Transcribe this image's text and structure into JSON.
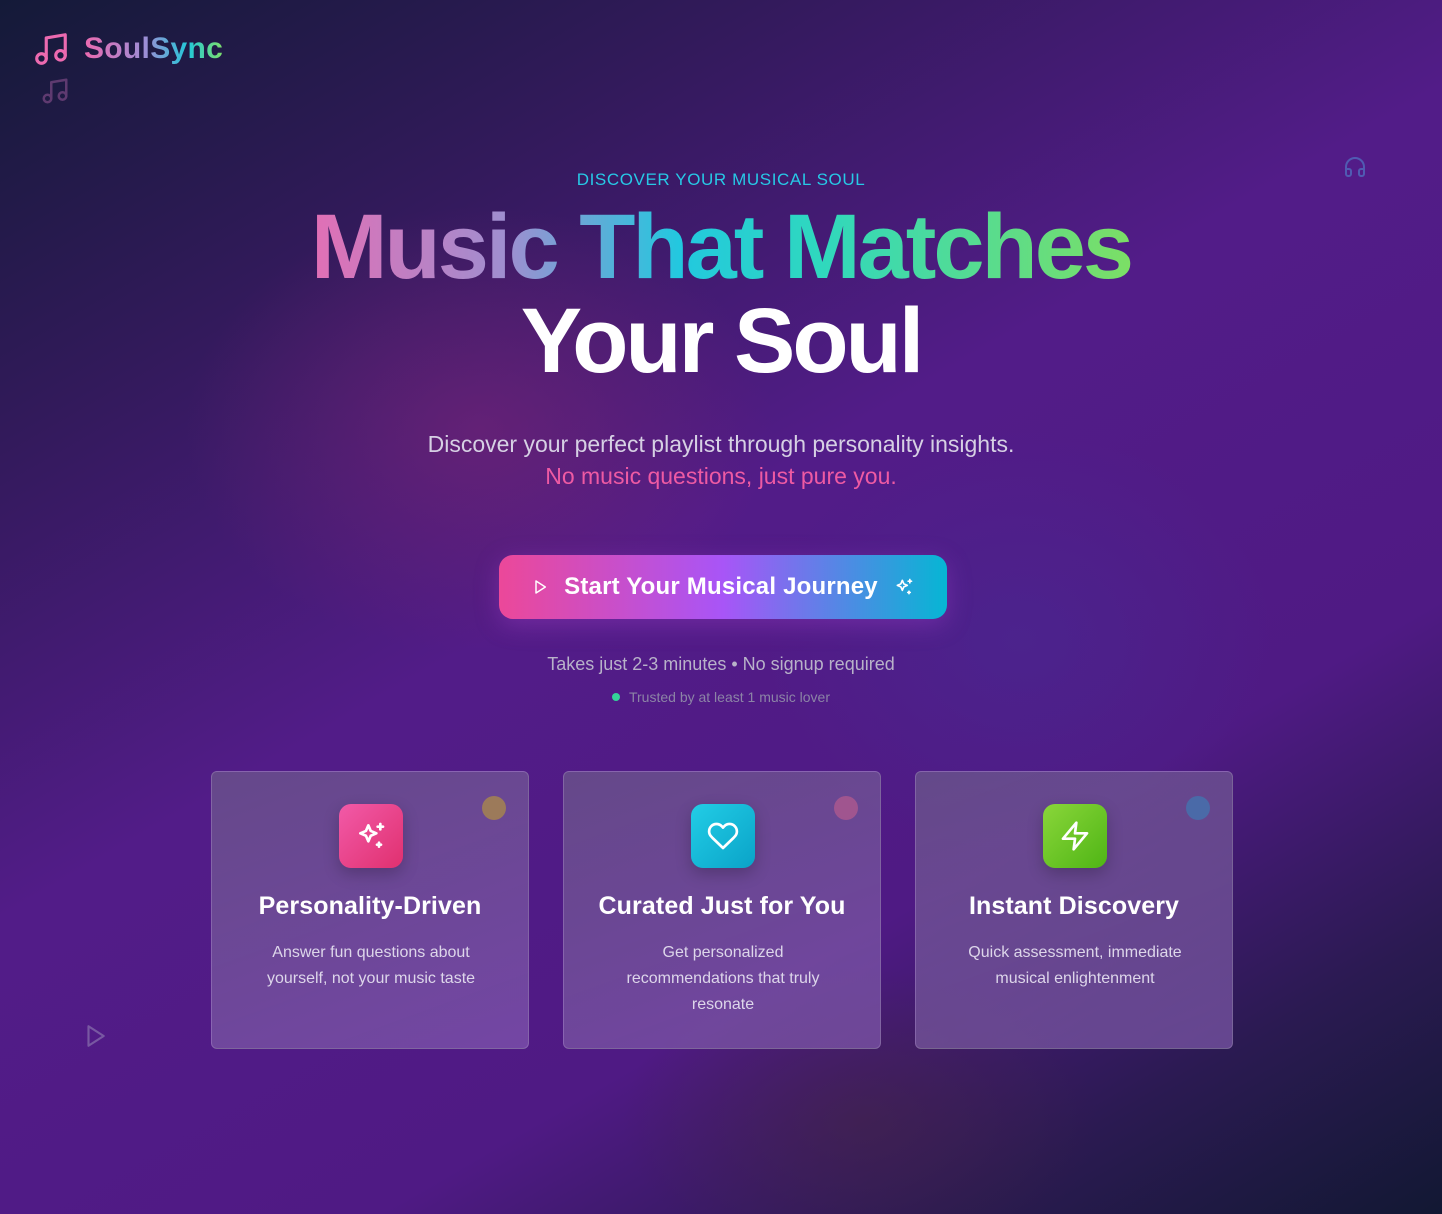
{
  "brand": {
    "name": "SoulSync",
    "logo_icon": "music-note-icon"
  },
  "hero": {
    "eyebrow": "DISCOVER YOUR MUSICAL SOUL",
    "headline_line1": "Music That Matches",
    "headline_line2": "Your Soul",
    "subtitle": "Discover your perfect playlist through personality insights.",
    "subtitle_accent": "No music questions, just pure you."
  },
  "cta": {
    "label": "Start Your Musical Journey",
    "leading_icon": "play-icon",
    "trailing_icon": "sparkles-icon"
  },
  "note": "Takes just 2-3 minutes • No signup required",
  "trust": "Trusted by at least 1 music lover",
  "features": [
    {
      "title": "Personality-Driven",
      "description": "Answer fun questions about yourself, not your music taste",
      "icon": "sparkles-icon",
      "accent": "#ec4899",
      "dot_color": "#9c7a5a"
    },
    {
      "title": "Curated Just for You",
      "description": "Get personalized recommendations that truly resonate",
      "icon": "heart-icon",
      "accent": "#06b6d4",
      "dot_color": "#a0558f"
    },
    {
      "title": "Instant Discovery",
      "description": "Quick assessment, immediate musical enlightenment",
      "icon": "lightning-icon",
      "accent": "#65c820",
      "dot_color": "#4a6aa8"
    }
  ],
  "colors": {
    "background_dark": "#141a38",
    "background_purple": "#521c88",
    "eyebrow": "#27c9e6",
    "accent_pink": "#ee5aa3",
    "trust_dot": "#34d399"
  }
}
